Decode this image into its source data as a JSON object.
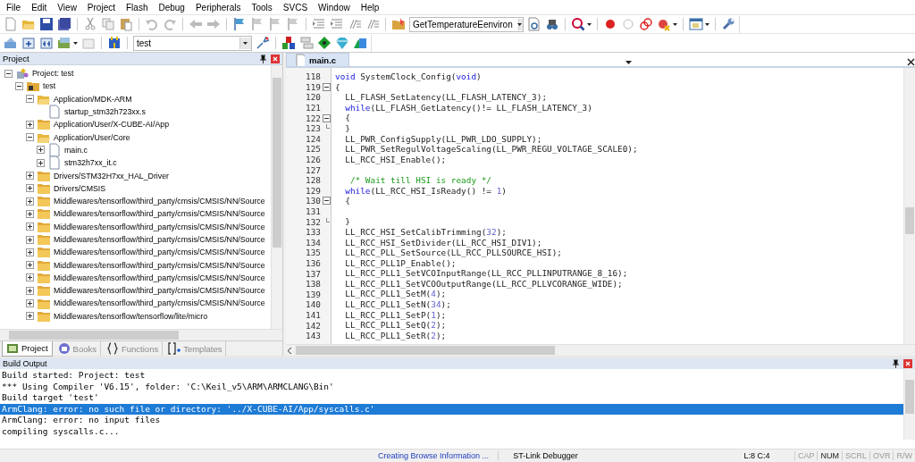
{
  "menu": [
    "File",
    "Edit",
    "View",
    "Project",
    "Flash",
    "Debug",
    "Peripherals",
    "Tools",
    "SVCS",
    "Window",
    "Help"
  ],
  "toolbar": {
    "find_combo": "GetTemperatureEenviron",
    "target_combo": "test"
  },
  "project_panel": {
    "title": "Project",
    "tree": [
      {
        "label": "Project: test",
        "kind": "project",
        "expanded": true,
        "children": [
          {
            "label": "test",
            "kind": "target",
            "expanded": true,
            "children": [
              {
                "label": "Application/MDK-ARM",
                "kind": "folder",
                "expanded": true,
                "children": [
                  {
                    "label": "startup_stm32h723xx.s",
                    "kind": "file"
                  }
                ]
              },
              {
                "label": "Application/User/X-CUBE-AI/App",
                "kind": "folder",
                "expanded": false
              },
              {
                "label": "Application/User/Core",
                "kind": "folder",
                "expanded": true,
                "children": [
                  {
                    "label": "main.c",
                    "kind": "file",
                    "expanded": false
                  },
                  {
                    "label": "stm32h7xx_it.c",
                    "kind": "file",
                    "expanded": false
                  }
                ]
              },
              {
                "label": "Drivers/STM32H7xx_HAL_Driver",
                "kind": "folder",
                "expanded": false
              },
              {
                "label": "Drivers/CMSIS",
                "kind": "folder",
                "expanded": false
              },
              {
                "label": "Middlewares/tensorflow/third_party/cmsis/CMSIS/NN/Source",
                "kind": "folder",
                "expanded": false
              },
              {
                "label": "Middlewares/tensorflow/third_party/cmsis/CMSIS/NN/Source",
                "kind": "folder",
                "expanded": false
              },
              {
                "label": "Middlewares/tensorflow/third_party/cmsis/CMSIS/NN/Source",
                "kind": "folder",
                "expanded": false
              },
              {
                "label": "Middlewares/tensorflow/third_party/cmsis/CMSIS/NN/Source",
                "kind": "folder",
                "expanded": false
              },
              {
                "label": "Middlewares/tensorflow/third_party/cmsis/CMSIS/NN/Source",
                "kind": "folder",
                "expanded": false
              },
              {
                "label": "Middlewares/tensorflow/third_party/cmsis/CMSIS/NN/Source",
                "kind": "folder",
                "expanded": false
              },
              {
                "label": "Middlewares/tensorflow/third_party/cmsis/CMSIS/NN/Source",
                "kind": "folder",
                "expanded": false
              },
              {
                "label": "Middlewares/tensorflow/third_party/cmsis/CMSIS/NN/Source",
                "kind": "folder",
                "expanded": false
              },
              {
                "label": "Middlewares/tensorflow/third_party/cmsis/CMSIS/NN/Source",
                "kind": "folder",
                "expanded": false
              },
              {
                "label": "Middlewares/tensorflow/tensorflow/lite/micro",
                "kind": "folder",
                "expanded": false
              }
            ]
          }
        ]
      }
    ],
    "tabs": [
      {
        "label": "Project",
        "kind": "project",
        "selected": true
      },
      {
        "label": "Books",
        "kind": "books",
        "selected": false
      },
      {
        "label": "Functions",
        "kind": "functions",
        "selected": false
      },
      {
        "label": "Templates",
        "kind": "templates",
        "selected": false
      }
    ]
  },
  "editor": {
    "tabs": [
      {
        "label": "main.c",
        "selected": true
      }
    ],
    "lines": [
      {
        "number": "118",
        "segments": [
          {
            "kind": "keyword",
            "text": "void"
          },
          {
            "kind": "plain",
            "text": " SystemClock_Config("
          },
          {
            "kind": "keyword",
            "text": "void"
          },
          {
            "kind": "plain",
            "text": ")"
          }
        ]
      },
      {
        "number": "119",
        "fold_start": true,
        "segments": [
          {
            "kind": "plain",
            "text": "{"
          }
        ]
      },
      {
        "number": "120",
        "segments": [
          {
            "kind": "plain",
            "text": "  LL_FLASH_SetLatency(LL_FLASH_LATENCY_3);"
          }
        ]
      },
      {
        "number": "121",
        "segments": [
          {
            "kind": "keyword",
            "text": "  while"
          },
          {
            "kind": "plain",
            "text": "(LL_FLASH_GetLatency()!= LL_FLASH_LATENCY_3)"
          }
        ]
      },
      {
        "number": "122",
        "fold_start": true,
        "segments": [
          {
            "kind": "plain",
            "text": "  {"
          }
        ]
      },
      {
        "number": "123",
        "fold_end": true,
        "segments": [
          {
            "kind": "plain",
            "text": "  }"
          }
        ]
      },
      {
        "number": "124",
        "segments": [
          {
            "kind": "plain",
            "text": "  LL_PWR_ConfigSupply(LL_PWR_LDO_SUPPLY);"
          }
        ]
      },
      {
        "number": "125",
        "segments": [
          {
            "kind": "plain",
            "text": "  LL_PWR_SetRegulVoltageScaling(LL_PWR_REGU_VOLTAGE_SCALE0);"
          }
        ]
      },
      {
        "number": "126",
        "segments": [
          {
            "kind": "plain",
            "text": "  LL_RCC_HSI_Enable();"
          }
        ]
      },
      {
        "number": "127"
      },
      {
        "number": "128",
        "segments": [
          {
            "kind": "comment",
            "text": "   /* Wait till HSI is ready */"
          }
        ]
      },
      {
        "number": "129",
        "segments": [
          {
            "kind": "keyword",
            "text": "  while"
          },
          {
            "kind": "plain",
            "text": "(LL_RCC_HSI_IsReady() != "
          },
          {
            "kind": "number",
            "text": "1"
          },
          {
            "kind": "plain",
            "text": ")"
          }
        ]
      },
      {
        "number": "130",
        "fold_start": true,
        "segments": [
          {
            "kind": "plain",
            "text": "  {"
          }
        ]
      },
      {
        "number": "131"
      },
      {
        "number": "132",
        "fold_end": true,
        "segments": [
          {
            "kind": "plain",
            "text": "  }"
          }
        ]
      },
      {
        "number": "133",
        "segments": [
          {
            "kind": "plain",
            "text": "  LL_RCC_HSI_SetCalibTrimming("
          },
          {
            "kind": "number",
            "text": "32"
          },
          {
            "kind": "plain",
            "text": ");"
          }
        ]
      },
      {
        "number": "134",
        "segments": [
          {
            "kind": "plain",
            "text": "  LL_RCC_HSI_SetDivider(LL_RCC_HSI_DIV1);"
          }
        ]
      },
      {
        "number": "135",
        "segments": [
          {
            "kind": "plain",
            "text": "  LL_RCC_PLL_SetSource(LL_RCC_PLLSOURCE_HSI);"
          }
        ]
      },
      {
        "number": "136",
        "segments": [
          {
            "kind": "plain",
            "text": "  LL_RCC_PLL1P_Enable();"
          }
        ]
      },
      {
        "number": "137",
        "segments": [
          {
            "kind": "plain",
            "text": "  LL_RCC_PLL1_SetVCOInputRange(LL_RCC_PLLINPUTRANGE_8_16);"
          }
        ]
      },
      {
        "number": "138",
        "segments": [
          {
            "kind": "plain",
            "text": "  LL_RCC_PLL1_SetVCOOutputRange(LL_RCC_PLLVCORANGE_WIDE);"
          }
        ]
      },
      {
        "number": "139",
        "segments": [
          {
            "kind": "plain",
            "text": "  LL_RCC_PLL1_SetM("
          },
          {
            "kind": "number",
            "text": "4"
          },
          {
            "kind": "plain",
            "text": ");"
          }
        ]
      },
      {
        "number": "140",
        "segments": [
          {
            "kind": "plain",
            "text": "  LL_RCC_PLL1_SetN("
          },
          {
            "kind": "number",
            "text": "34"
          },
          {
            "kind": "plain",
            "text": ");"
          }
        ]
      },
      {
        "number": "141",
        "segments": [
          {
            "kind": "plain",
            "text": "  LL_RCC_PLL1_SetP("
          },
          {
            "kind": "number",
            "text": "1"
          },
          {
            "kind": "plain",
            "text": ");"
          }
        ]
      },
      {
        "number": "142",
        "segments": [
          {
            "kind": "plain",
            "text": "  LL_RCC_PLL1_SetQ("
          },
          {
            "kind": "number",
            "text": "2"
          },
          {
            "kind": "plain",
            "text": ");"
          }
        ]
      },
      {
        "number": "143",
        "segments": [
          {
            "kind": "plain",
            "text": "  LL_RCC_PLL1_SetR("
          },
          {
            "kind": "number",
            "text": "2"
          },
          {
            "kind": "plain",
            "text": ");"
          }
        ]
      }
    ]
  },
  "build_output": {
    "title": "Build Output",
    "lines": [
      {
        "text": "Build started: Project: test",
        "selected": false
      },
      {
        "text": "*** Using Compiler 'V6.15', folder: 'C:\\Keil_v5\\ARM\\ARMCLANG\\Bin'",
        "selected": false
      },
      {
        "text": "Build target 'test'",
        "selected": false
      },
      {
        "text": "ArmClang: error: no such file or directory: '../X-CUBE-AI/App/syscalls.c'",
        "selected": true
      },
      {
        "text": "ArmClang: error: no input files",
        "selected": false
      },
      {
        "text": "compiling syscalls.c...",
        "selected": false
      }
    ]
  },
  "status_bar": {
    "message": "Creating Browse Information ...",
    "debugger": "ST-Link Debugger",
    "position": "L:8 C:4",
    "indicators": [
      {
        "label": "CAP",
        "on": false
      },
      {
        "label": "NUM",
        "on": true
      },
      {
        "label": "SCRL",
        "on": false
      },
      {
        "label": "OVR",
        "on": false
      },
      {
        "label": "R/W",
        "on": false
      }
    ]
  }
}
